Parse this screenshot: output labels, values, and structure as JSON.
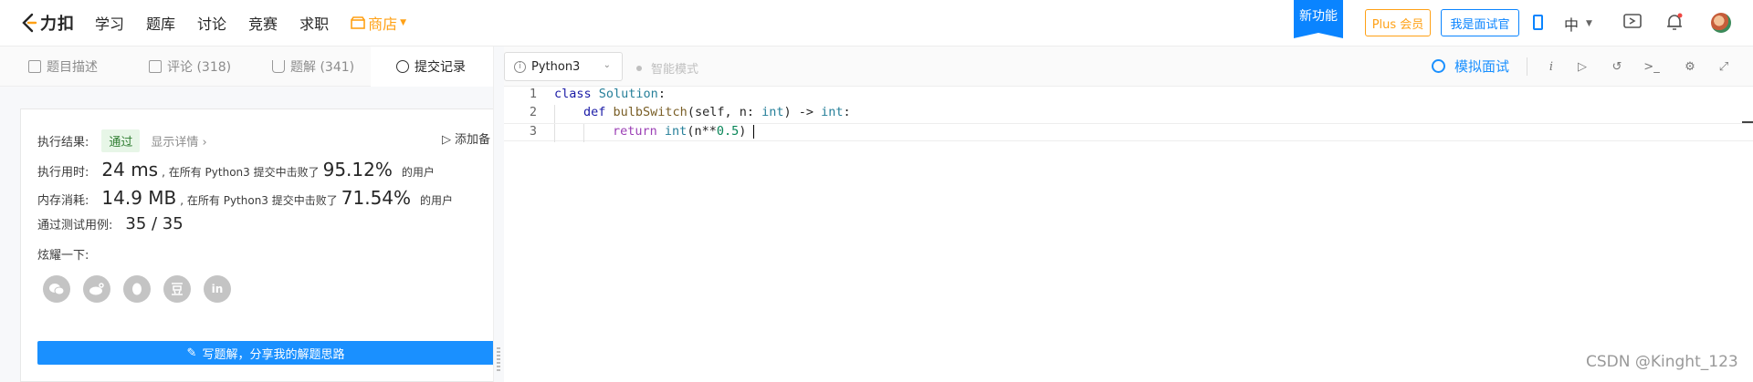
{
  "nav": {
    "logo_text": "力扣",
    "items": [
      "学习",
      "题库",
      "讨论",
      "竞赛",
      "求职"
    ],
    "store_label": "商店",
    "new_feature": "新功能",
    "plus_label": "Plus 会员",
    "interviewer_label": "我是面试官",
    "language": "中"
  },
  "tabs": [
    {
      "label": "题目描述",
      "icon": "description-icon"
    },
    {
      "label": "评论 (318)",
      "icon": "comment-icon"
    },
    {
      "label": "题解 (341)",
      "icon": "flask-icon"
    },
    {
      "label": "提交记录",
      "icon": "clock-icon"
    }
  ],
  "result": {
    "status_label": "执行结果:",
    "status": "通过",
    "detail_link": "显示详情",
    "add_note": "添加备",
    "runtime_label": "执行用时:",
    "runtime_value": "24 ms",
    "runtime_text": ", 在所有 Python3 提交中击败了",
    "runtime_percent": "95.12%",
    "users_text": "的用户",
    "memory_label": "内存消耗:",
    "memory_value": "14.9 MB",
    "memory_text": ", 在所有 Python3 提交中击败了",
    "memory_percent": "71.54%",
    "tests_label": "通过测试用例:",
    "tests_value": "35 / 35",
    "share_label": "炫耀一下:",
    "share_icons": [
      "wechat-icon",
      "weibo-icon",
      "qq-icon",
      "douban-icon",
      "linkedin-icon"
    ],
    "write_solution": "写题解，分享我的解题思路"
  },
  "editor": {
    "language": "Python3",
    "smart_mode": "智能模式",
    "mock_interview": "模拟面试",
    "lines": [
      {
        "num": "1",
        "code": "class Solution:"
      },
      {
        "num": "2",
        "code": "def bulbSwitch(self, n: int) -> int:"
      },
      {
        "num": "3",
        "code": "return int(n**0.5)"
      }
    ]
  },
  "watermark": "CSDN @Kinght_123"
}
